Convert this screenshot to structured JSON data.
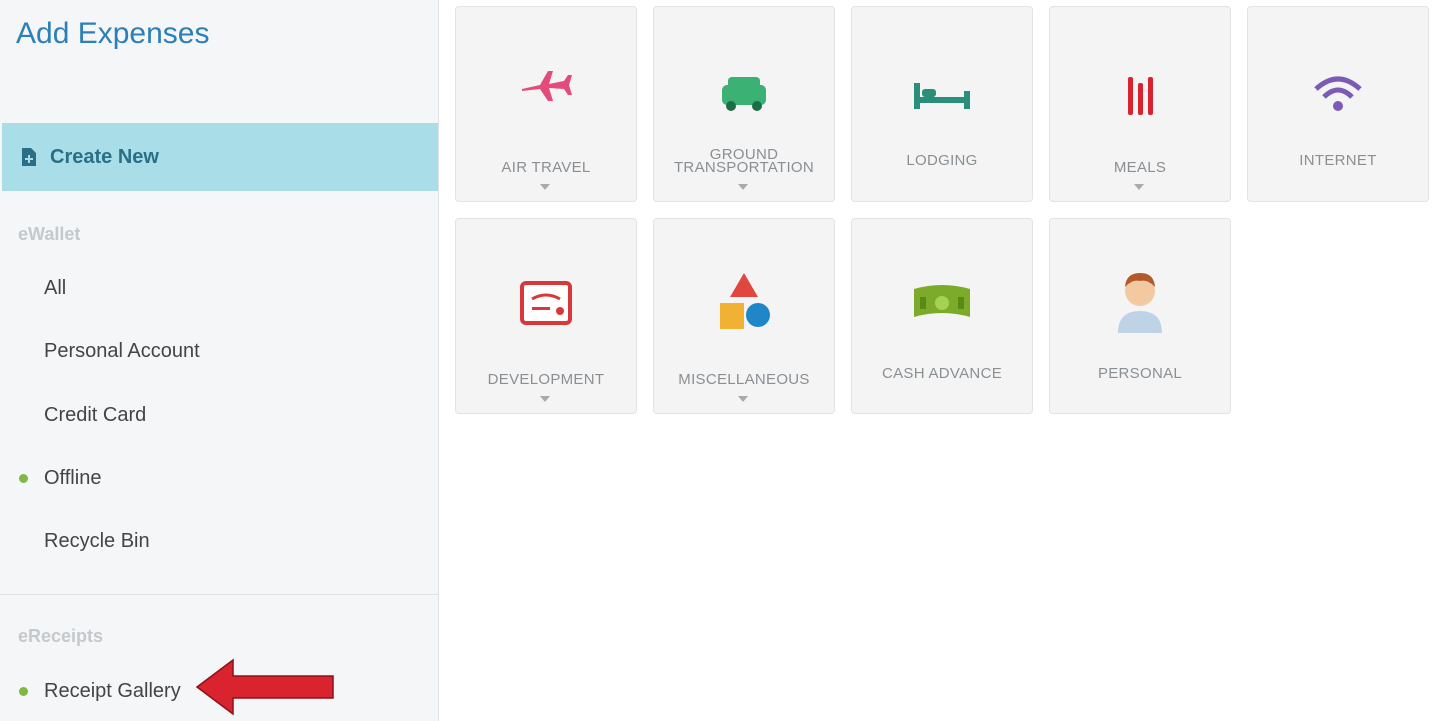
{
  "page": {
    "title": "Add Expenses"
  },
  "create_new": {
    "label": "Create New",
    "icon": "add-document-icon"
  },
  "ewallet": {
    "label": "eWallet",
    "items": [
      {
        "label": "All"
      },
      {
        "label": "Personal Account"
      },
      {
        "label": "Credit Card"
      },
      {
        "label": "Offline",
        "status": "online-dot"
      },
      {
        "label": "Recycle Bin"
      }
    ]
  },
  "ereceipts": {
    "label": "eReceipts",
    "items": [
      {
        "label": "Receipt Gallery",
        "status": "online-dot"
      }
    ]
  },
  "categories": [
    {
      "label": "AIR TRAVEL",
      "icon": "airplane-icon",
      "has_dropdown": true
    },
    {
      "label": "GROUND TRANSPORTATION",
      "line1": "GROUND",
      "line2": "TRANSPORTATION",
      "icon": "car-icon",
      "has_dropdown": true
    },
    {
      "label": "LODGING",
      "icon": "bed-icon",
      "has_dropdown": false
    },
    {
      "label": "MEALS",
      "icon": "utensils-icon",
      "has_dropdown": true
    },
    {
      "label": "INTERNET",
      "icon": "wifi-icon",
      "has_dropdown": false
    },
    {
      "label": "DEVELOPMENT",
      "icon": "certificate-icon",
      "has_dropdown": true
    },
    {
      "label": "MISCELLANEOUS",
      "icon": "shapes-icon",
      "has_dropdown": true
    },
    {
      "label": "CASH ADVANCE",
      "icon": "cash-icon",
      "has_dropdown": false
    },
    {
      "label": "PERSONAL",
      "icon": "person-icon",
      "has_dropdown": false
    }
  ],
  "colors": {
    "title": "#2c7fb8",
    "create_new_bg": "#a9dde8",
    "create_new_text": "#2a6f86",
    "status_dot": "#7fb843",
    "annotation_arrow": "#d9232e"
  },
  "annotation": {
    "icon": "red-arrow-pointer-icon"
  }
}
